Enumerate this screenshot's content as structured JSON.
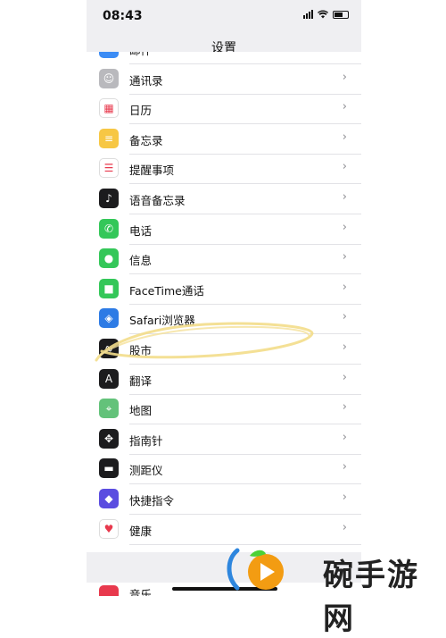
{
  "status_bar": {
    "time": "08:43"
  },
  "nav": {
    "title": "设置"
  },
  "settings": {
    "items": [
      {
        "label": "邮件",
        "icon": "mail-icon",
        "color": "#3b8cf5"
      },
      {
        "label": "通讯录",
        "icon": "contacts-icon",
        "color": "#b9b9bd"
      },
      {
        "label": "日历",
        "icon": "calendar-icon",
        "color": "#ffffff"
      },
      {
        "label": "备忘录",
        "icon": "notes-icon",
        "color": "#f7c744"
      },
      {
        "label": "提醒事项",
        "icon": "reminders-icon",
        "color": "#ffffff"
      },
      {
        "label": "语音备忘录",
        "icon": "voice-memos-icon",
        "color": "#1c1c1e"
      },
      {
        "label": "电话",
        "icon": "phone-icon",
        "color": "#34c759"
      },
      {
        "label": "信息",
        "icon": "messages-icon",
        "color": "#34c759"
      },
      {
        "label": "FaceTime通话",
        "icon": "facetime-icon",
        "color": "#34c759"
      },
      {
        "label": "Safari浏览器",
        "icon": "safari-icon",
        "color": "#2d7be5"
      },
      {
        "label": "股市",
        "icon": "stocks-icon",
        "color": "#1c1c1e"
      },
      {
        "label": "翻译",
        "icon": "translate-icon",
        "color": "#1c1c1e"
      },
      {
        "label": "地图",
        "icon": "maps-icon",
        "color": "#63c27a"
      },
      {
        "label": "指南针",
        "icon": "compass-icon",
        "color": "#1c1c1e"
      },
      {
        "label": "测距仪",
        "icon": "measure-icon",
        "color": "#1c1c1e"
      },
      {
        "label": "快捷指令",
        "icon": "shortcuts-icon",
        "color": "#5b4de0"
      },
      {
        "label": "健康",
        "icon": "health-icon",
        "color": "#ffffff"
      }
    ],
    "next_section_item": {
      "label": "音乐",
      "icon": "music-icon",
      "color": "#e8394d"
    }
  },
  "chevron": "›",
  "watermark": {
    "text": "碗手游网"
  },
  "highlight_color": "#f3dd8a"
}
